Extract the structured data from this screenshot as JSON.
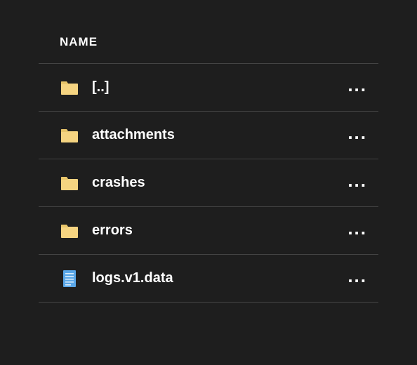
{
  "header": {
    "name_label": "NAME"
  },
  "colors": {
    "folder_fill": "#f5d481",
    "folder_tab": "#e8c56a",
    "file_fill": "#5aa7e8",
    "file_lines": "#d8ecfb"
  },
  "rows": [
    {
      "type": "folder",
      "name": "[..]"
    },
    {
      "type": "folder",
      "name": "attachments"
    },
    {
      "type": "folder",
      "name": "crashes"
    },
    {
      "type": "folder",
      "name": "errors"
    },
    {
      "type": "file",
      "name": "logs.v1.data"
    }
  ],
  "actions": {
    "more_label": "..."
  }
}
